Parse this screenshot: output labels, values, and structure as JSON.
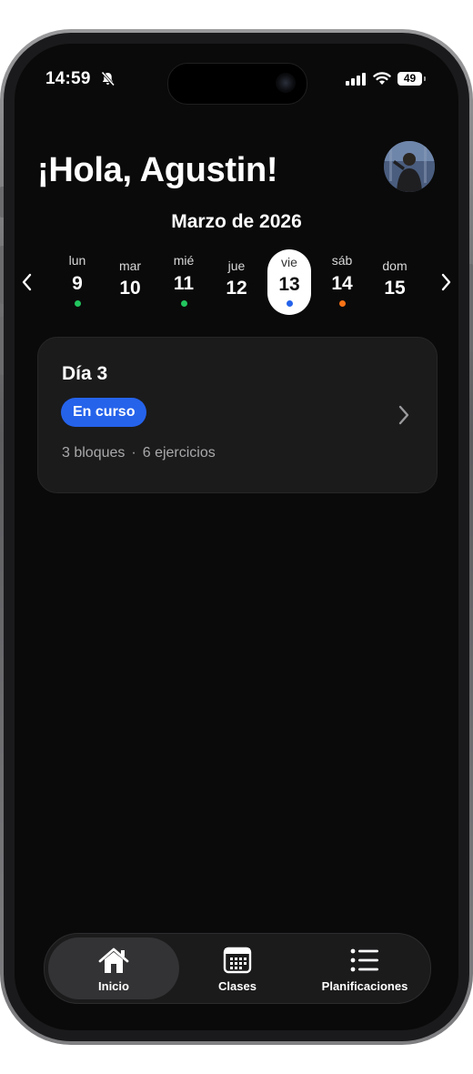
{
  "status_bar": {
    "time": "14:59",
    "battery": "49"
  },
  "greeting": "¡Hola, Agustin!",
  "calendar": {
    "month_label": "Marzo de 2026",
    "days": [
      {
        "name": "lun",
        "number": "9",
        "dot": "#22c55e"
      },
      {
        "name": "mar",
        "number": "10",
        "dot": null
      },
      {
        "name": "mié",
        "number": "11",
        "dot": "#22c55e"
      },
      {
        "name": "jue",
        "number": "12",
        "dot": null
      },
      {
        "name": "vie",
        "number": "13",
        "dot": "#2563eb",
        "selected": true
      },
      {
        "name": "sáb",
        "number": "14",
        "dot": "#f97316"
      },
      {
        "name": "dom",
        "number": "15",
        "dot": null
      }
    ]
  },
  "workout_card": {
    "title": "Día 3",
    "status": "En curso",
    "blocks": "3 bloques",
    "separator": "·",
    "exercises": "6 ejercicios"
  },
  "tab_bar": {
    "tabs": [
      {
        "label": "Inicio",
        "icon": "home-icon",
        "active": true
      },
      {
        "label": "Clases",
        "icon": "calendar-icon",
        "active": false
      },
      {
        "label": "Planificaciones",
        "icon": "list-icon",
        "active": false
      }
    ]
  },
  "colors": {
    "accent": "#2563eb",
    "green_dot": "#22c55e",
    "orange_dot": "#f97316",
    "background": "#0a0a0a",
    "card": "#1b1b1c"
  }
}
